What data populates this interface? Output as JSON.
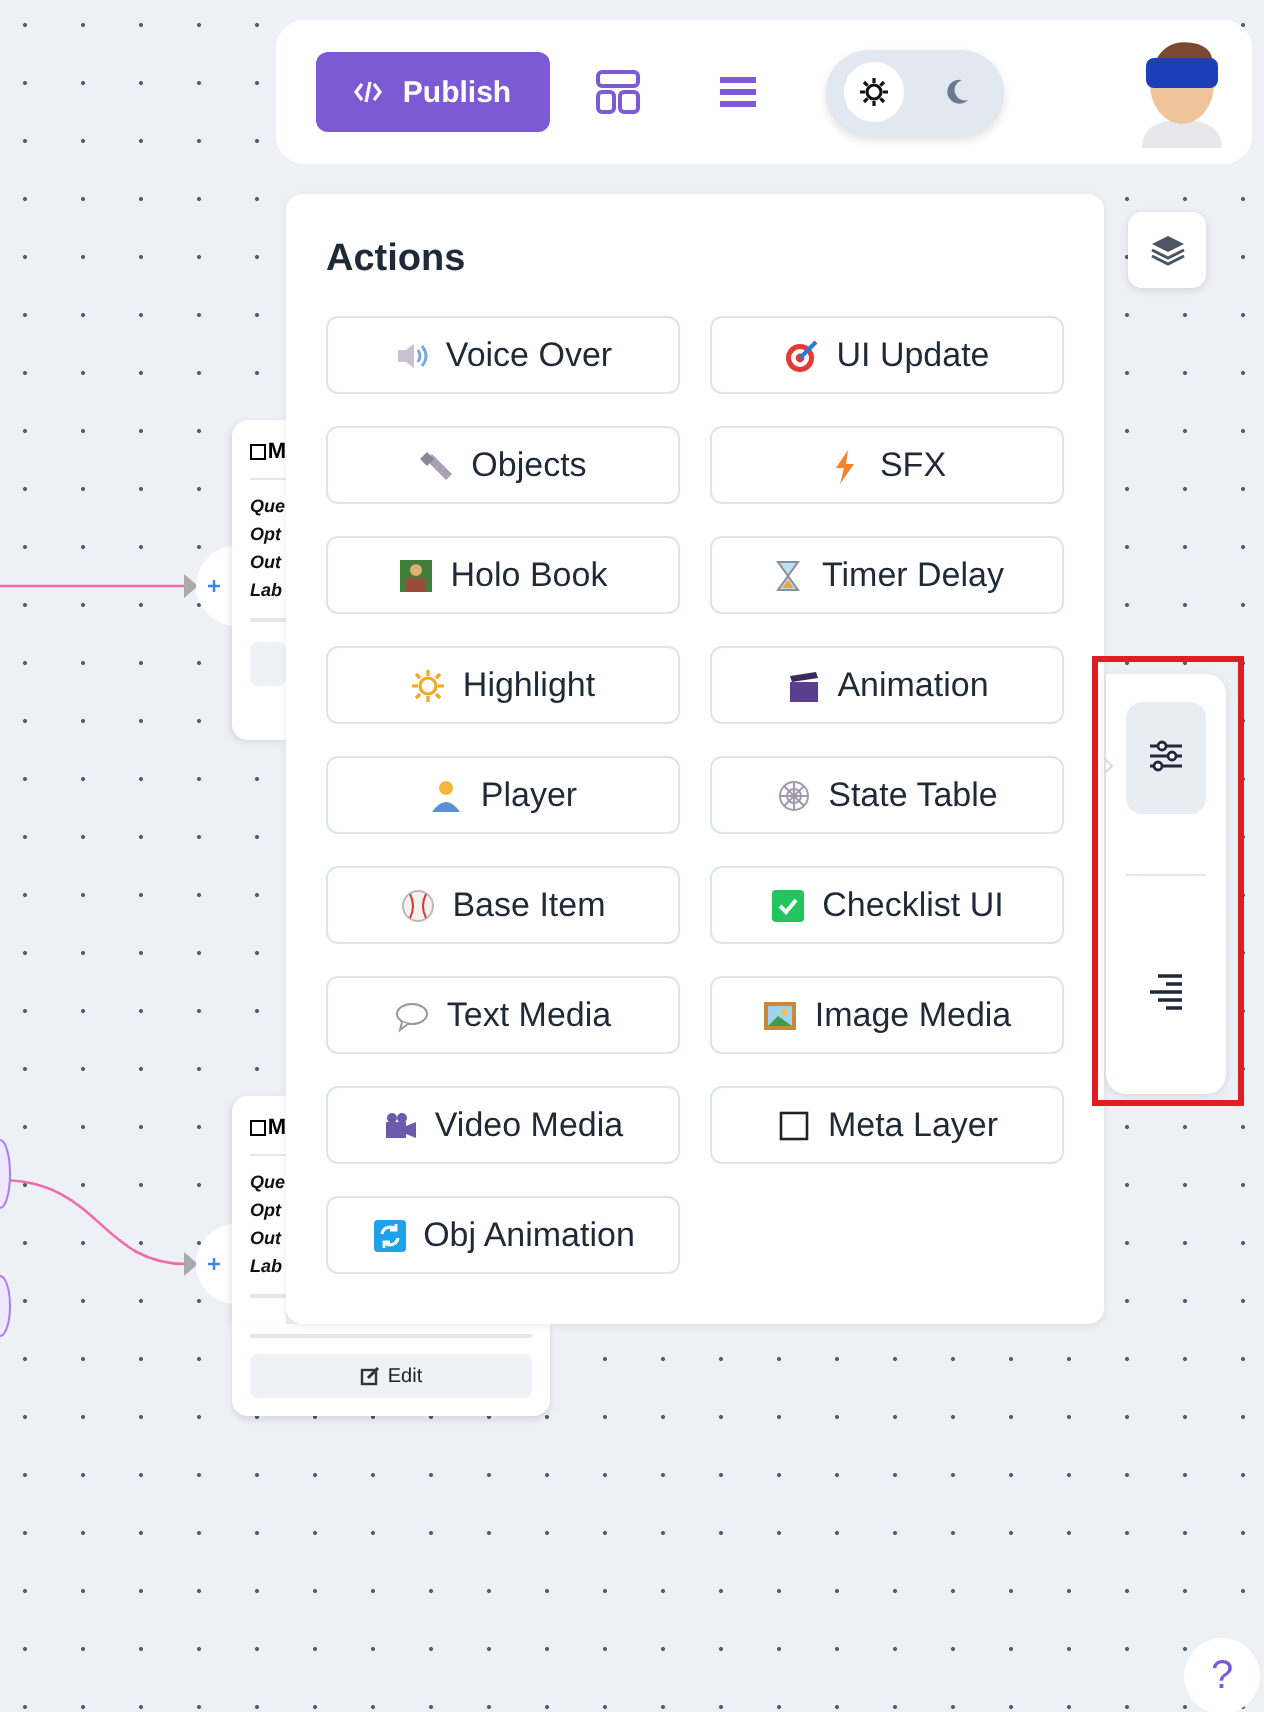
{
  "toolbar": {
    "publish_label": "Publish",
    "theme_options": [
      {
        "kind": "sun",
        "selected": true
      },
      {
        "kind": "moon",
        "selected": false
      }
    ]
  },
  "nodes": [
    {
      "title": "M",
      "fields": [
        "Que",
        "Opt",
        "Out",
        "Lab"
      ]
    },
    {
      "title": "M",
      "fields": [
        "Que",
        "Opt",
        "Out",
        "Lab"
      ],
      "edit_label": "Edit"
    }
  ],
  "actions_panel": {
    "title": "Actions",
    "actions": [
      {
        "label": "Voice Over"
      },
      {
        "label": "UI Update"
      },
      {
        "label": "Objects"
      },
      {
        "label": "SFX"
      },
      {
        "label": "Holo Book"
      },
      {
        "label": "Timer Delay"
      },
      {
        "label": "Highlight"
      },
      {
        "label": "Animation"
      },
      {
        "label": "Player"
      },
      {
        "label": "State Table"
      },
      {
        "label": "Base Item"
      },
      {
        "label": "Checklist UI"
      },
      {
        "label": "Text Media"
      },
      {
        "label": "Image Media"
      },
      {
        "label": "Video Media"
      },
      {
        "label": "Meta Layer"
      },
      {
        "label": "Obj Animation"
      }
    ]
  },
  "side_tools": [
    {
      "kind": "sliders",
      "selected": true
    },
    {
      "kind": "align-right",
      "selected": false
    }
  ],
  "help_label": "?"
}
